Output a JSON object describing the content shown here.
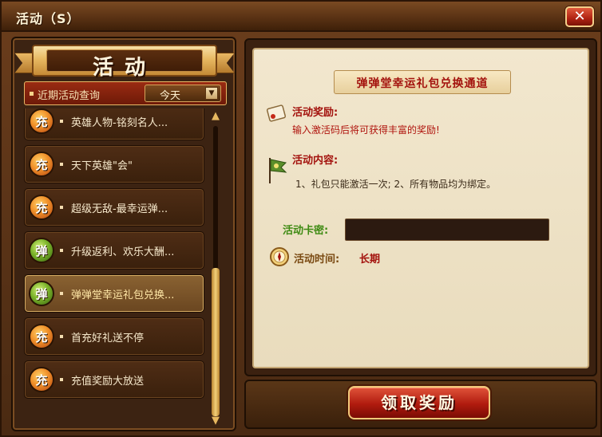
{
  "window": {
    "title": "活动（S）",
    "close_label": "✕"
  },
  "banner": {
    "title": "活动"
  },
  "query": {
    "label": "近期活动查询",
    "selected": "今天",
    "arrow": "▼"
  },
  "list": {
    "items": [
      {
        "badge": "充",
        "badge_color": "#f0902a",
        "text": "英雄人物-铭刻名人..."
      },
      {
        "badge": "充",
        "badge_color": "#f0902a",
        "text": "天下英雄\"会\""
      },
      {
        "badge": "充",
        "badge_color": "#f0902a",
        "text": "超级无敌-最幸运弹..."
      },
      {
        "badge": "弹",
        "badge_color": "#7ab22a",
        "text": "升级返利、欢乐大酬..."
      },
      {
        "badge": "弹",
        "badge_color": "#7ab22a",
        "text": "弹弹堂幸运礼包兑换..."
      },
      {
        "badge": "充",
        "badge_color": "#f0902a",
        "text": "首充好礼送不停"
      },
      {
        "badge": "充",
        "badge_color": "#f0902a",
        "text": "充值奖励大放送"
      }
    ],
    "selected_index": 4
  },
  "scrollbar": {
    "up": "▲",
    "down": "▼"
  },
  "detail": {
    "header": "弹弹堂幸运礼包兑换通道",
    "reward_label": "活动奖励:",
    "reward_body": "输入激活码后将可获得丰富的奖励!",
    "content_label": "活动内容:",
    "content_body": "1、礼包只能激活一次; 2、所有物品均为绑定。",
    "code_label": "活动卡密:",
    "code_value": "",
    "time_label": "活动时间:",
    "time_value": "长期"
  },
  "claim_button": {
    "label": "领取奖励"
  }
}
